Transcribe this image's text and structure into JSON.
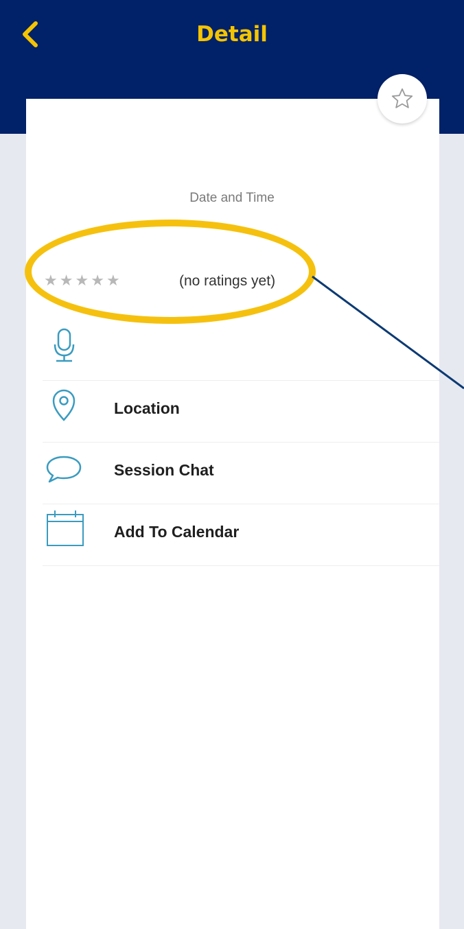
{
  "header": {
    "title": "Detail"
  },
  "session": {
    "date_time_label": "Date and Time",
    "rating": {
      "stars_filled": 0,
      "stars_total": 5,
      "text": "(no ratings yet)"
    }
  },
  "actions": [
    {
      "label": "",
      "icon": "microphone-icon"
    },
    {
      "label": "Location",
      "icon": "map-pin-icon"
    },
    {
      "label": "Session Chat",
      "icon": "chat-bubble-icon"
    },
    {
      "label": "Add To Calendar",
      "icon": "calendar-icon"
    }
  ],
  "colors": {
    "header_bg": "#012169",
    "accent_yellow": "#f5c400",
    "icon_teal": "#3a9bbf",
    "highlight": "#f5c10e",
    "annotation_line": "#0b3a73"
  }
}
